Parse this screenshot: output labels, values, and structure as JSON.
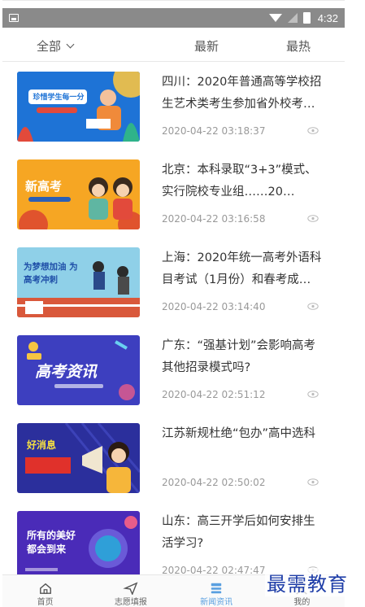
{
  "status_bar": {
    "time": "4:32"
  },
  "tabs": [
    {
      "label": "全部"
    },
    {
      "label": "最新"
    },
    {
      "label": "最热"
    }
  ],
  "articles": [
    {
      "title": "四川：2020年普通高等学校招生艺术类考生参加省外校考…",
      "date": "2020-04-22 03:18:37",
      "thumb_text": "珍惜学生每一分"
    },
    {
      "title": "北京：本科录取“3+3”模式、实行院校专业组……20…",
      "date": "2020-04-22 03:16:58",
      "thumb_text": "新高考"
    },
    {
      "title": "上海：2020年统一高考外语科目考试（1月份）和春考成…",
      "date": "2020-04-22 03:14:40",
      "thumb_text": "为梦想加油 为高考冲刺"
    },
    {
      "title": "广东：“强基计划”会影响高考其他招录模式吗?",
      "date": "2020-04-22 02:51:12",
      "thumb_text": "高考资讯"
    },
    {
      "title": "江苏新规杜绝“包办”高中选科",
      "date": "2020-04-22 02:50:02",
      "thumb_text": "好消息"
    },
    {
      "title": "山东：高三开学后如何安排生活学习?",
      "date": "2020-04-22 02:47:47",
      "thumb_text": "所有的美好都会到来"
    }
  ],
  "bottom_nav": [
    {
      "label": "首页",
      "icon": "home-icon"
    },
    {
      "label": "志愿填报",
      "icon": "send-icon"
    },
    {
      "label": "新闻资讯",
      "icon": "news-icon"
    },
    {
      "label": "我的",
      "icon": "user-icon"
    }
  ],
  "watermark": "最需教育",
  "colors": {
    "accent": "#5aa0e0",
    "statusbar": "#8a8a8a"
  }
}
